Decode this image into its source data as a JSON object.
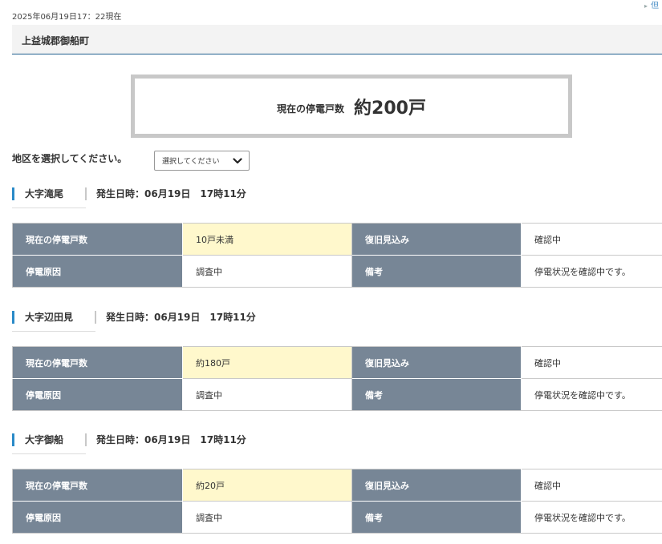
{
  "header": {
    "timestamp": "2025年06月19日17：22現在",
    "corner_link": "但"
  },
  "town": {
    "name": "上益城郡御船町"
  },
  "summary": {
    "label": "現在の停電戸数",
    "value": "約200戸"
  },
  "district_selector": {
    "label": "地区を選択してください。",
    "selected": "選択してください"
  },
  "table_labels": {
    "current_outages": "現在の停電戸数",
    "restoration": "復旧見込み",
    "cause": "停電原因",
    "remarks": "備考"
  },
  "areas": [
    {
      "name": "大字滝尾",
      "occurred": "発生日時：06月19日　17時11分",
      "current_outages": "10戸未満",
      "restoration": "確認中",
      "cause": "調査中",
      "remarks": "停電状況を確認中です。"
    },
    {
      "name": "大字辺田見",
      "occurred": "発生日時：06月19日　17時11分",
      "current_outages": "約180戸",
      "restoration": "確認中",
      "cause": "調査中",
      "remarks": "停電状況を確認中です。"
    },
    {
      "name": "大字御船",
      "occurred": "発生日時：06月19日　17時11分",
      "current_outages": "約20戸",
      "restoration": "確認中",
      "cause": "調査中",
      "remarks": "停電状況を確認中です。"
    }
  ]
}
